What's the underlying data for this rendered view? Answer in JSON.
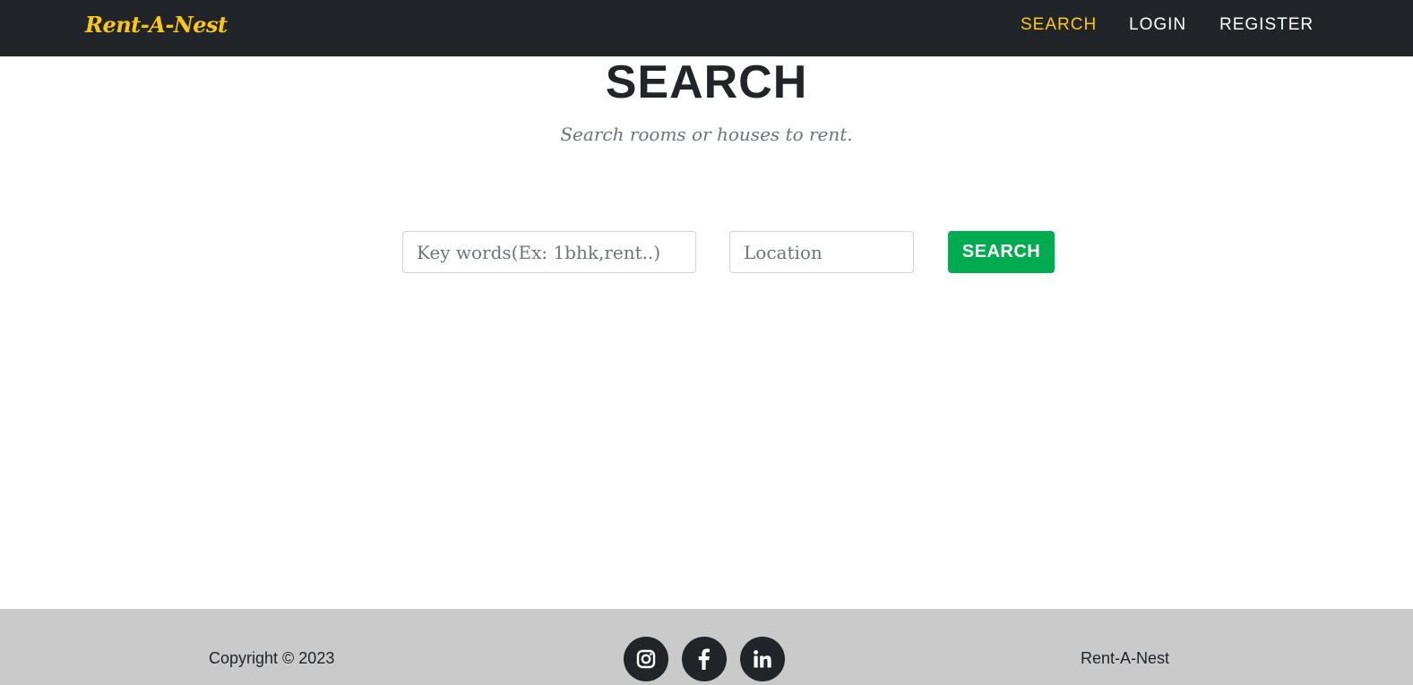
{
  "nav": {
    "brand": "Rent-A-Nest",
    "items": [
      {
        "label": "SEARCH",
        "active": true
      },
      {
        "label": "LOGIN",
        "active": false
      },
      {
        "label": "REGISTER",
        "active": false
      }
    ]
  },
  "main": {
    "heading": "SEARCH",
    "subheading": "Search rooms or houses to rent.",
    "keywords_placeholder": "Key words(Ex: 1bhk,rent..)",
    "location_placeholder": "Location",
    "search_button": "SEARCH"
  },
  "footer": {
    "copyright": "Copyright © 2023",
    "brand": "Rent-A-Nest",
    "social": [
      "instagram-icon",
      "facebook-icon",
      "linkedin-icon"
    ]
  },
  "colors": {
    "navbar_bg": "#212529",
    "accent_yellow": "#fec810",
    "button_green": "#00aa4f",
    "footer_bg": "#cacaca"
  }
}
